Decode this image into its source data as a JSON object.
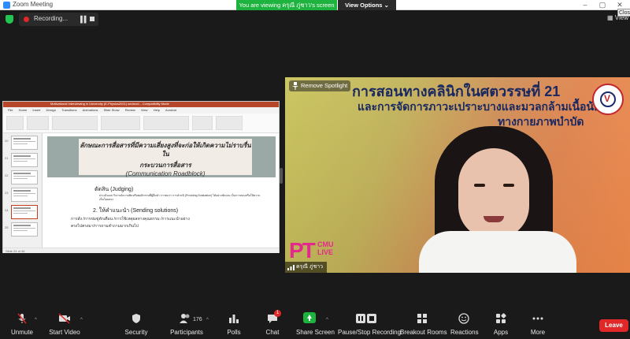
{
  "window": {
    "title": "Zoom Meeting"
  },
  "share_banner": {
    "viewing_text": "You are viewing ครุณี ภู่ชาว's screen",
    "view_options_label": "View Options"
  },
  "recording": {
    "label": "Recording..."
  },
  "top_right": {
    "view_label": "View",
    "close_tooltip": "Clos"
  },
  "shared_screen": {
    "ppt_title": "Motivational Interviewing in University (E-Physics2021) section1 - Compatibility Mode",
    "menu_tabs": [
      "File",
      "Home",
      "Insert",
      "Design",
      "Transitions",
      "Animations",
      "Slide Show",
      "Review",
      "View",
      "Help",
      "Acrobat"
    ],
    "slide_numbers": [
      "20",
      "21",
      "22",
      "23",
      "24",
      "25"
    ],
    "slide_title": "ลักษณะการสื่อสารที่มีความเสี่ยงสูงที่จะก่อให้เกิดความไม่ราบรื่นใน",
    "slide_title_2": "กระบวนการสื่อสาร",
    "slide_subtitle": "(Communication Roadblock)",
    "bullet_1": "ตัดสิน (Judging)",
    "bullet_1_detail": "ประเมินและวิจารณ์ความคิดหรือพฤติกรรมที่ผู้อื่นทำ การต่อว่า การตำหนิ (Providing Evaluation) ได้อย่างชัดเจน เป็นการสอนหรือให้ความเห็นโดยตรง",
    "bullet_2": "2. ให้คำแนะนำ (Sending solutions)",
    "bullet_3": "การสั่ง /การข่มขู่ตักเตือน /การใช้เหตุผลทางคุณธรรม /การแนะนำอย่าง",
    "bullet_4": "ตรงไปตรงมา/การถามคำถามมากเกินไป",
    "status_text": "Slide 24 of 46"
  },
  "video_tile": {
    "banner_line1": "การสอนทางคลินิกในศตวรรษที่ 21",
    "banner_line2": "และการจัดการภาวะเปราะบางและมวลกล้ามเนื้อน้อย",
    "banner_line3": "ทางกายภาพบำบัด",
    "spotlight_label": "Remove Spotlight",
    "logo_pt": "PT",
    "logo_cmu": "CMU",
    "logo_live": "LIVE",
    "participant_name": "ครุณี ภู่ชาว"
  },
  "toolbar": {
    "unmute": "Unmute",
    "start_video": "Start Video",
    "security": "Security",
    "participants": "Participants",
    "participants_count": "176",
    "polls": "Polls",
    "chat": "Chat",
    "chat_badge": "1",
    "share_screen": "Share Screen",
    "pause_recording": "Pause/Stop Recording",
    "breakout": "Breakout Rooms",
    "reactions": "Reactions",
    "apps": "Apps",
    "more": "More",
    "leave": "Leave"
  },
  "colors": {
    "accent_green": "#1eb23f",
    "leave_red": "#e02828",
    "zoom_blue": "#2d8cff",
    "ppt_orange": "#b7472a"
  }
}
